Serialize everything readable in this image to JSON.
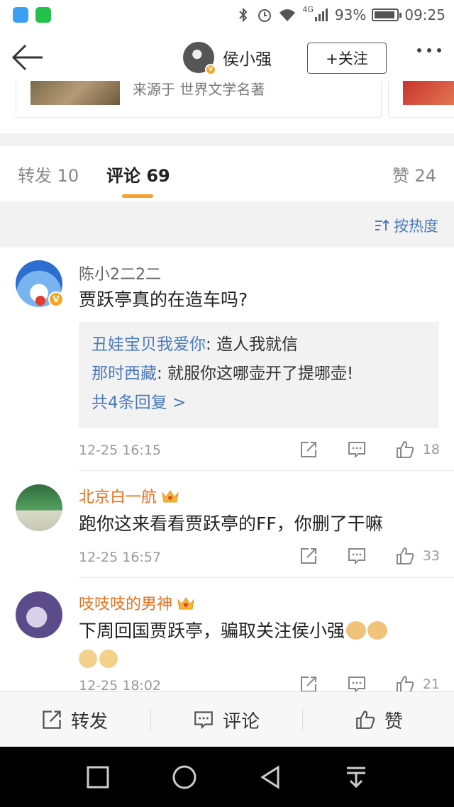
{
  "statusbar": {
    "network": "4G",
    "battery_text": "93%",
    "battery_level": 0.93,
    "time": "09:25",
    "icons": [
      "message-app-icon",
      "wechat-icon",
      "bluetooth-icon",
      "alarm-icon",
      "wifi-icon",
      "signal-icon",
      "battery-icon"
    ]
  },
  "navbar": {
    "user_name": "侯小强",
    "follow_label": "+关注"
  },
  "preview_card": {
    "text": "来源于 世界文学名著"
  },
  "tabs": {
    "repost": "转发 10",
    "comment": "评论 69",
    "likes": "赞 24"
  },
  "sort": {
    "label": "按热度"
  },
  "comments": [
    {
      "name": "陈小2二2二",
      "text": "贾跃亭真的在造车吗?",
      "replies": [
        {
          "who": "丑娃宝贝我爱你",
          "text": ": 造人我就信"
        },
        {
          "who": "那时西藏",
          "text": ": 就服你这哪壶开了提哪壶!"
        }
      ],
      "more_replies": "共4条回复 >",
      "time": "12-25 16:15",
      "likes": "18"
    },
    {
      "name": "北京白一航",
      "text": "跑你这来看看贾跃亭的FF，你删了干嘛",
      "time": "12-25 16:57",
      "likes": "33"
    },
    {
      "name": "吱吱吱的男神",
      "text": "下周回国贾跃亭，骗取关注侯小强",
      "time": "12-25 18:02",
      "likes": "21"
    }
  ],
  "bottombar": {
    "repost": "转发",
    "comment": "评论",
    "like": "赞"
  },
  "colors": {
    "accent_orange": "#f79f2c",
    "link_blue": "#4b7bbd",
    "vip_name": "#e86f1f"
  }
}
